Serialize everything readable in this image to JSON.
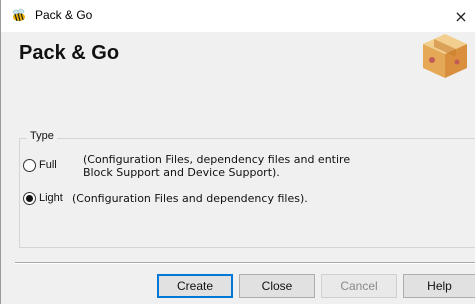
{
  "window": {
    "title": "Pack & Go",
    "close_glyph": "×",
    "icon": "bee-app-icon"
  },
  "header": {
    "title": "Pack & Go",
    "icon": "package-box-icon"
  },
  "type_group": {
    "legend": "Type",
    "options": [
      {
        "label": "Full",
        "description_line1": "(Configuration Files, dependency files and entire",
        "description_line2": "Block Support and Device Support).",
        "selected": false
      },
      {
        "label": "Light",
        "description_line1": "(Configuration Files and dependency files).",
        "selected": true
      }
    ]
  },
  "buttons": {
    "create": "Create",
    "close": "Close",
    "cancel": "Cancel",
    "help": "Help"
  },
  "colors": {
    "accent": "#0078d7",
    "box": "#e8b56a"
  }
}
